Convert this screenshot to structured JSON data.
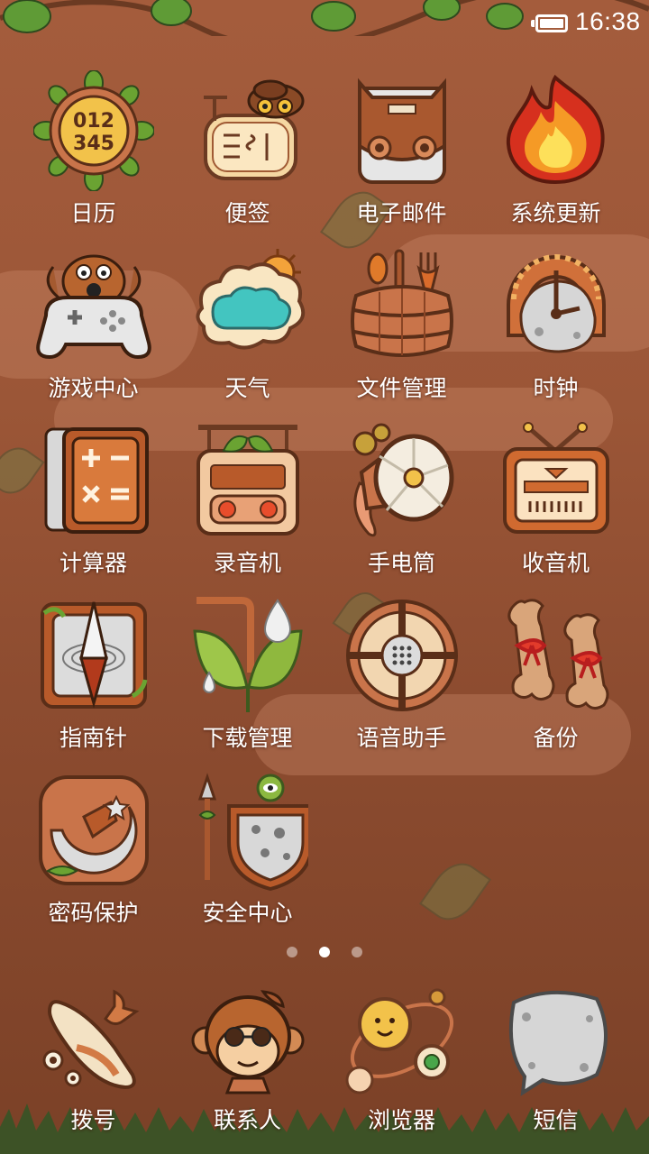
{
  "status_bar": {
    "time": "16:38",
    "battery_icon": "battery-full-icon"
  },
  "apps": [
    {
      "label": "日历",
      "icon": "calendar-sunflower-icon"
    },
    {
      "label": "便签",
      "icon": "notes-owl-icon"
    },
    {
      "label": "电子邮件",
      "icon": "email-satchel-icon"
    },
    {
      "label": "系统更新",
      "icon": "fire-update-icon"
    },
    {
      "label": "游戏中心",
      "icon": "gamepad-dog-icon"
    },
    {
      "label": "天气",
      "icon": "weather-cloud-sun-icon"
    },
    {
      "label": "文件管理",
      "icon": "barrel-utensils-icon"
    },
    {
      "label": "时钟",
      "icon": "horseshoe-clock-icon"
    },
    {
      "label": "计算器",
      "icon": "calculator-icon"
    },
    {
      "label": "录音机",
      "icon": "tape-recorder-icon"
    },
    {
      "label": "手电筒",
      "icon": "flashlight-icon"
    },
    {
      "label": "收音机",
      "icon": "radio-tv-icon"
    },
    {
      "label": "指南针",
      "icon": "compass-icon"
    },
    {
      "label": "下载管理",
      "icon": "download-leaves-icon"
    },
    {
      "label": "语音助手",
      "icon": "microphone-shield-icon"
    },
    {
      "label": "备份",
      "icon": "backup-bones-icon"
    },
    {
      "label": "密码保护",
      "icon": "password-moon-star-icon"
    },
    {
      "label": "安全中心",
      "icon": "security-shield-spear-icon"
    }
  ],
  "pagination": {
    "pages": 3,
    "current": 2
  },
  "dock": [
    {
      "label": "拨号",
      "icon": "phone-bone-icon"
    },
    {
      "label": "联系人",
      "icon": "contacts-monkey-icon"
    },
    {
      "label": "浏览器",
      "icon": "browser-planets-icon"
    },
    {
      "label": "短信",
      "icon": "sms-stone-icon"
    }
  ],
  "colors": {
    "background": "#9b5637",
    "label_text": "#ffffff",
    "accent_wood": "#c9744a",
    "leaf_green": "#7fae3c"
  }
}
